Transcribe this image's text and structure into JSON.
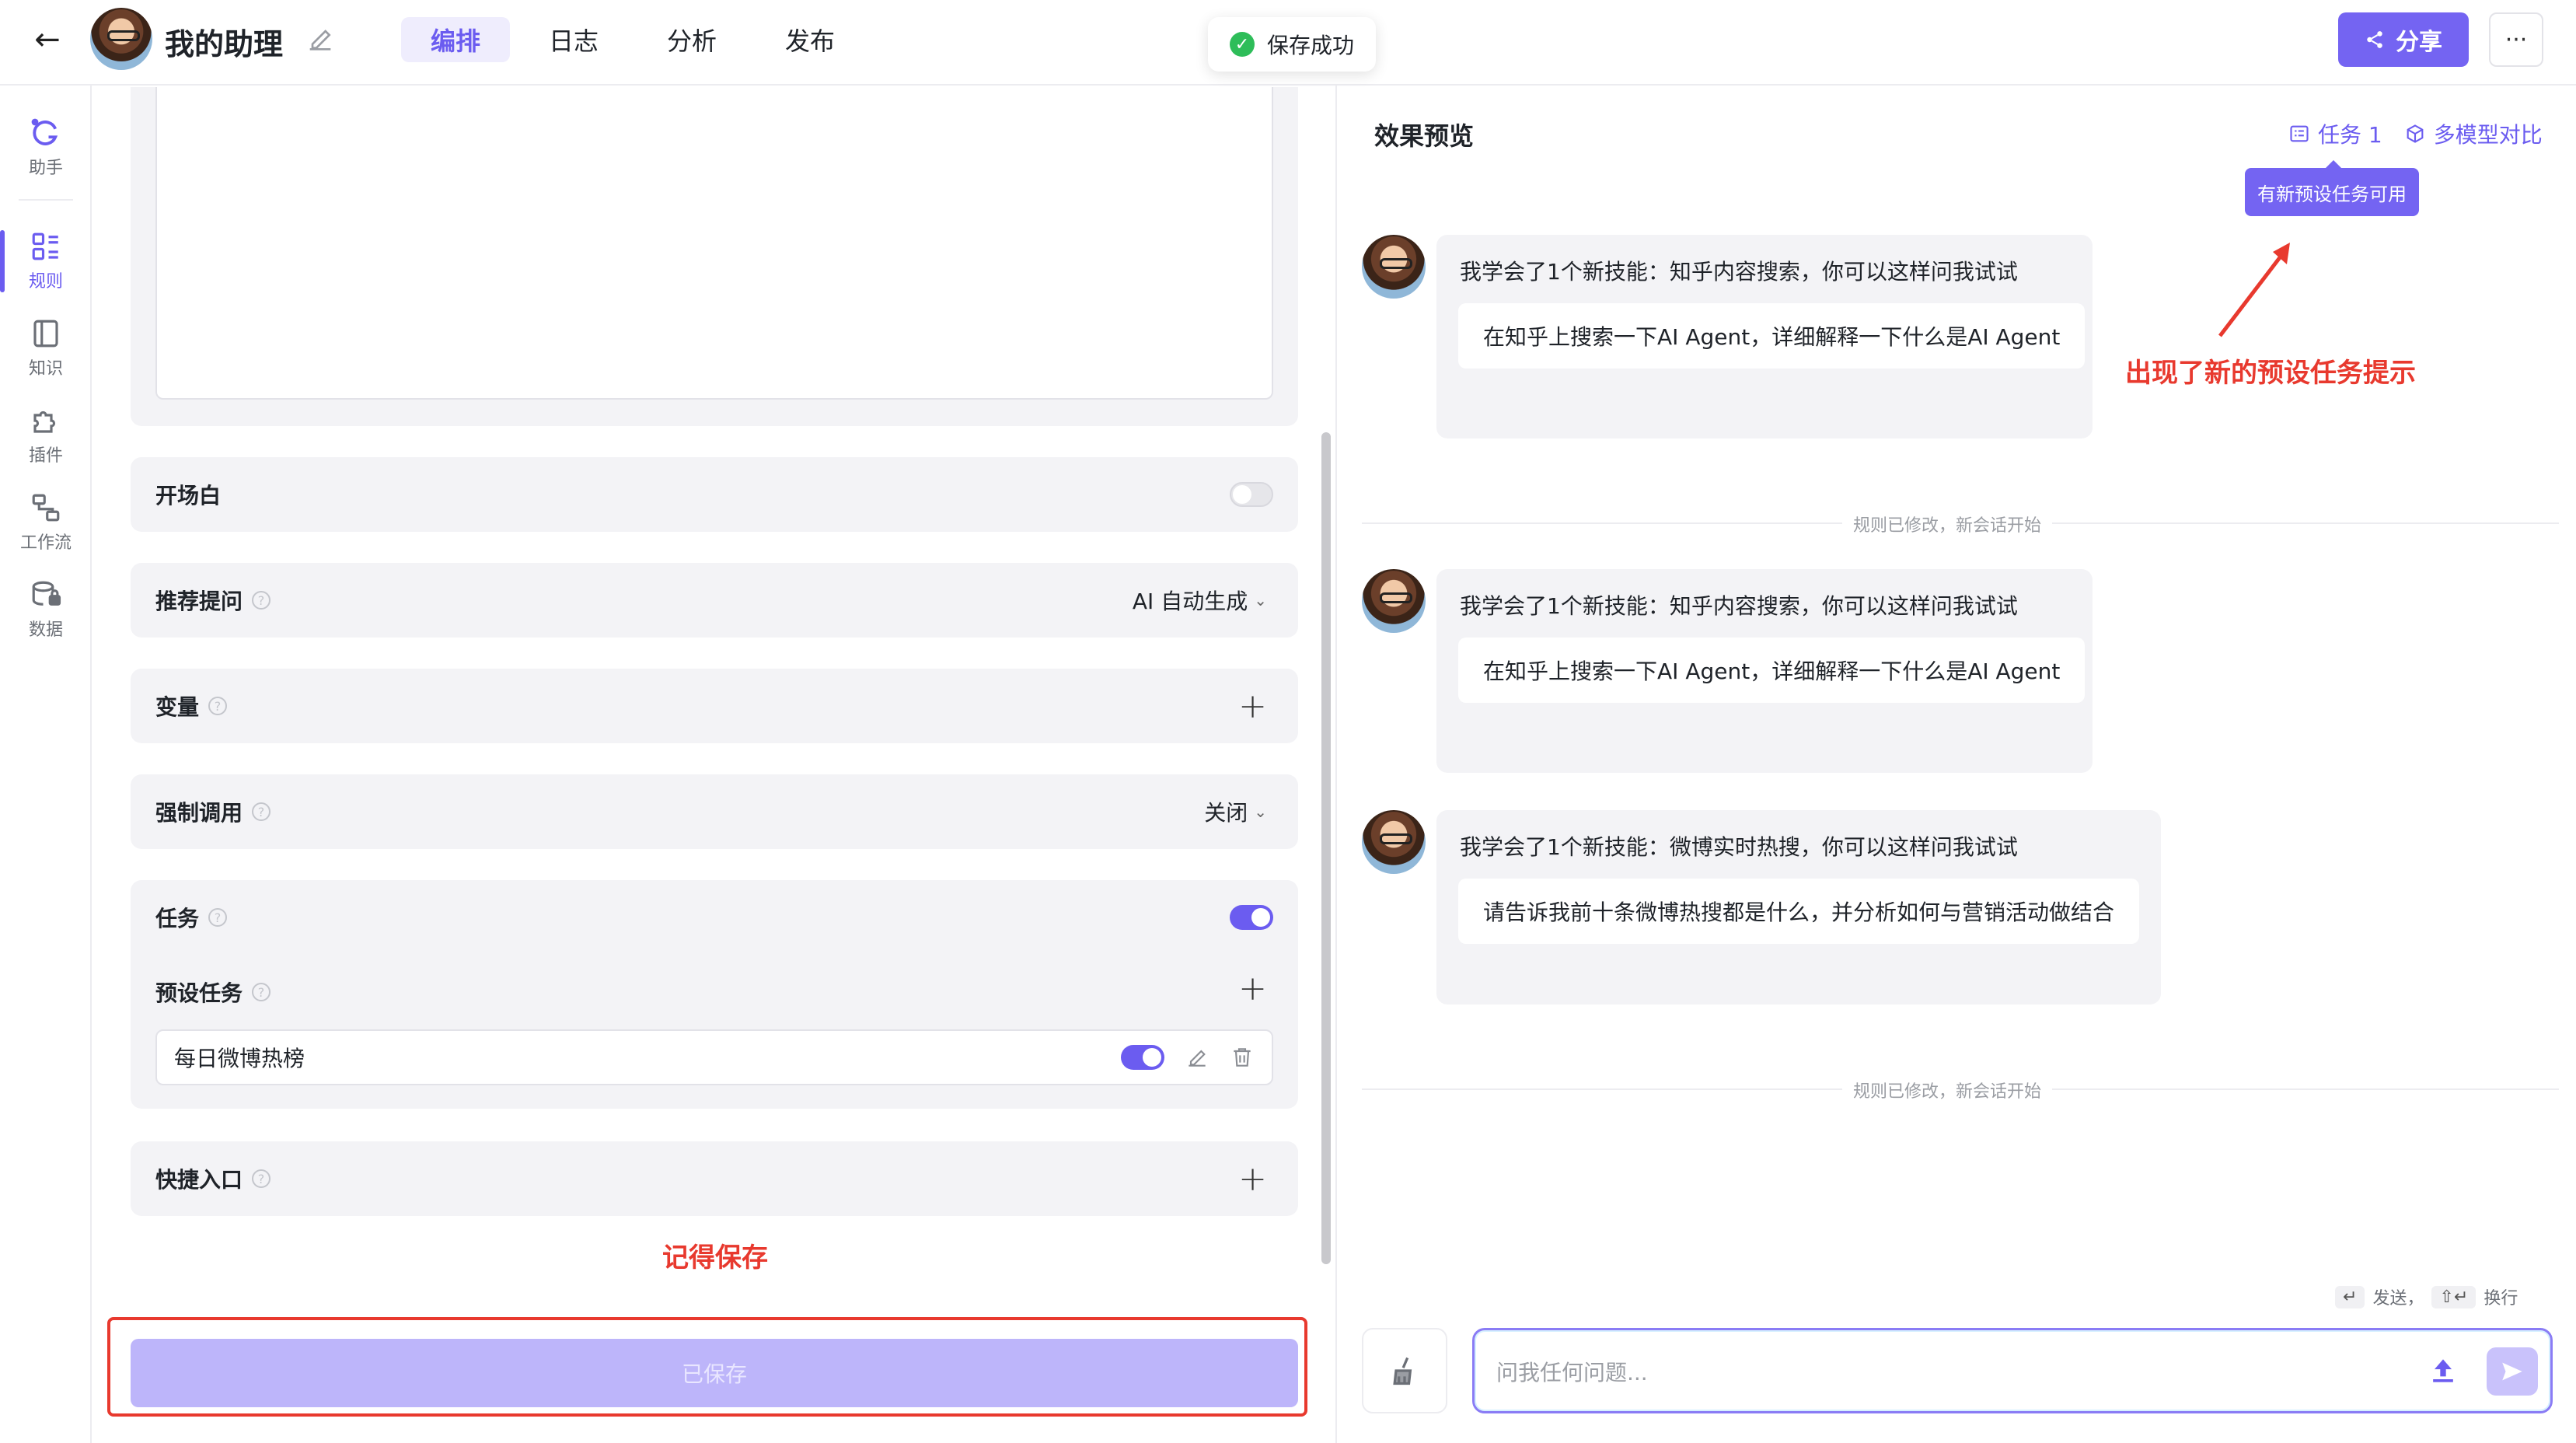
{
  "header": {
    "back_label": "←",
    "app_title": "我的助理",
    "tabs": [
      {
        "label": "编排",
        "active": true
      },
      {
        "label": "日志",
        "active": false
      },
      {
        "label": "分析",
        "active": false
      },
      {
        "label": "发布",
        "active": false
      }
    ],
    "toast": "保存成功",
    "share_label": "分享",
    "more_label": "···"
  },
  "sidebar": {
    "items": [
      {
        "label": "助手",
        "icon": "assistant-icon"
      },
      {
        "label": "规则",
        "icon": "rules-icon",
        "active": true
      },
      {
        "label": "知识",
        "icon": "knowledge-icon"
      },
      {
        "label": "插件",
        "icon": "plugin-icon"
      },
      {
        "label": "工作流",
        "icon": "workflow-icon"
      },
      {
        "label": "数据",
        "icon": "data-icon"
      }
    ]
  },
  "config": {
    "opening": {
      "label": "开场白",
      "enabled": false
    },
    "suggested": {
      "label": "推荐提问",
      "value": "AI 自动生成"
    },
    "variables": {
      "label": "变量",
      "action": "+"
    },
    "forced_call": {
      "label": "强制调用",
      "value": "关闭"
    },
    "tasks": {
      "label": "任务",
      "enabled": true,
      "preset_label": "预设任务",
      "preset_action": "+",
      "preset_items": [
        {
          "name": "每日微博热榜",
          "enabled": true
        }
      ]
    },
    "shortcut": {
      "label": "快捷入口",
      "action": "+"
    },
    "annotation_save": "记得保存",
    "saved_button": "已保存"
  },
  "preview": {
    "title": "效果预览",
    "task_button": "任务 1",
    "compare_button": "多模型对比",
    "tooltip": "有新预设任务可用",
    "annotation_task": "出现了新的预设任务提示",
    "messages": [
      {
        "head": "我学会了1个新技能：知乎内容搜索，你可以这样问我试试",
        "suggestion": "在知乎上搜索一下AI Agent，详细解释一下什么是AI Agent"
      },
      {
        "head": "我学会了1个新技能：知乎内容搜索，你可以这样问我试试",
        "suggestion": "在知乎上搜索一下AI Agent，详细解释一下什么是AI Agent"
      },
      {
        "head": "我学会了1个新技能：微博实时热搜，你可以这样问我试试",
        "suggestion": "请告诉我前十条微博热搜都是什么，并分析如何与营销活动做结合"
      }
    ],
    "system_notice": "规则已修改，新会话开始",
    "hint_send_key": "↵",
    "hint_send": "发送，",
    "hint_newline_key": "⇧↵",
    "hint_newline": "换行",
    "input_placeholder": "问我任何问题..."
  },
  "colors": {
    "accent": "#6b5cf0",
    "annotation_red": "#e8392e",
    "success": "#2ebd59"
  }
}
